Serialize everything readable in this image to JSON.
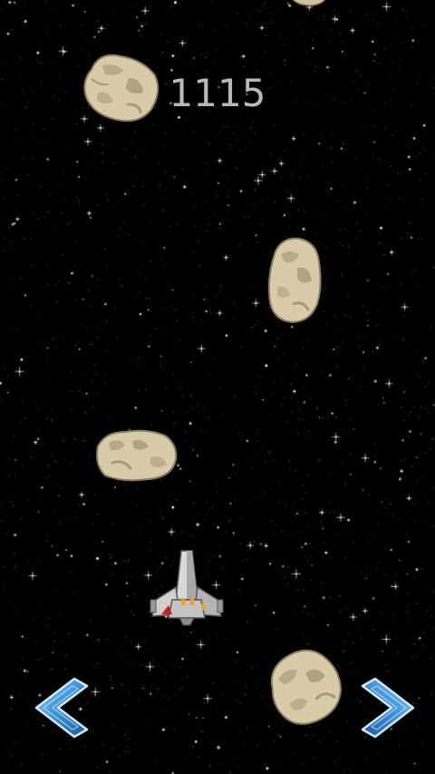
{
  "hud": {
    "score": "1115"
  },
  "controls": {
    "left": {
      "icon": "left-chevron-icon"
    },
    "right": {
      "icon": "right-chevron-icon"
    }
  },
  "entities": {
    "player": {
      "icon": "spaceship-icon"
    },
    "asteroid_icon": "asteroid-icon"
  },
  "colors": {
    "background": "#000000",
    "score_text": "#b9b9b9",
    "asteroid_fill": "#d5c8a8",
    "asteroid_shadow": "#a8987a",
    "button_blue": "#4f9fe0",
    "ship_body": "#c8c8c8",
    "ship_accent_red": "#c0202a",
    "ship_accent_orange": "#f0a020"
  }
}
